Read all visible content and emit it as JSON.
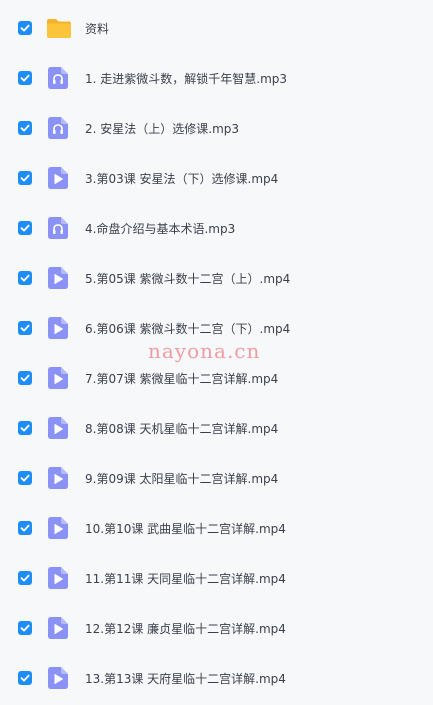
{
  "files": [
    {
      "name": "资料",
      "type": "folder",
      "checked": true
    },
    {
      "name": "1. 走进紫微斗数，解锁千年智慧.mp3",
      "type": "audio",
      "checked": true
    },
    {
      "name": "2. 安星法（上）选修课.mp3",
      "type": "audio",
      "checked": true
    },
    {
      "name": "3.第03课 安星法（下）选修课.mp4",
      "type": "video",
      "checked": true
    },
    {
      "name": "4.命盘介绍与基本术语.mp3",
      "type": "audio",
      "checked": true
    },
    {
      "name": "5.第05课 紫微斗数十二宫（上）.mp4",
      "type": "video",
      "checked": true
    },
    {
      "name": "6.第06课 紫微斗数十二宫（下）.mp4",
      "type": "video",
      "checked": true
    },
    {
      "name": "7.第07课 紫微星临十二宫详解.mp4",
      "type": "video",
      "checked": true
    },
    {
      "name": "8.第08课 天机星临十二宫详解.mp4",
      "type": "video",
      "checked": true
    },
    {
      "name": "9.第09课 太阳星临十二宫详解.mp4",
      "type": "video",
      "checked": true
    },
    {
      "name": "10.第10课 武曲星临十二宫详解.mp4",
      "type": "video",
      "checked": true
    },
    {
      "name": "11.第11课 天同星临十二宫详解.mp4",
      "type": "video",
      "checked": true
    },
    {
      "name": "12.第12课 廉贞星临十二宫详解.mp4",
      "type": "video",
      "checked": true
    },
    {
      "name": "13.第13课 天府星临十二宫详解.mp4",
      "type": "video",
      "checked": true
    }
  ],
  "watermark": "nayona.cn",
  "colors": {
    "checkbox": "#1f8df8",
    "file_icon": "#8a93f5",
    "folder": "#fbc43a",
    "text": "#3a3f4a",
    "background": "#f7f8fa",
    "watermark": "#f08c96"
  }
}
